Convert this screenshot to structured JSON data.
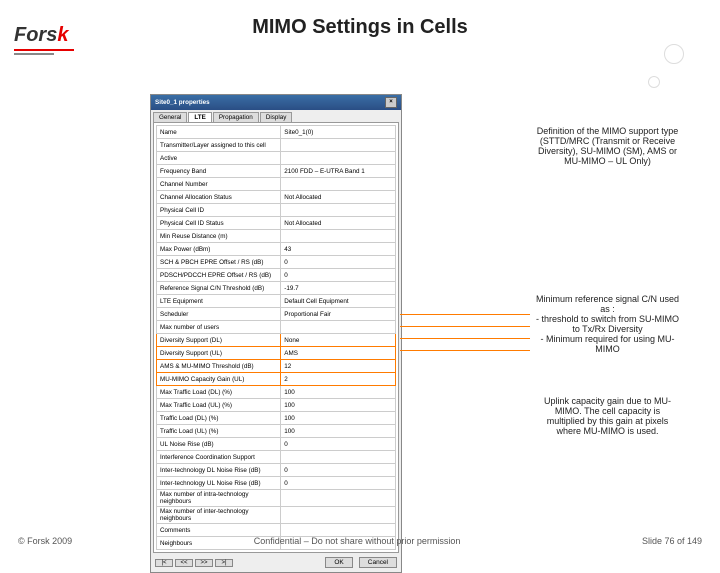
{
  "logo": {
    "text_a": "Fors",
    "text_b": "k"
  },
  "title": "MIMO Settings in Cells",
  "dialog": {
    "title": "Site0_1 properties",
    "tabs": [
      "General",
      "LTE",
      "Propagation",
      "Display"
    ],
    "active_tab_index": 1,
    "rows": [
      {
        "label": "Name",
        "value": "Site0_1(0)"
      },
      {
        "label": "Transmitter/Layer assigned to this cell",
        "value": ""
      },
      {
        "label": "Active",
        "value": ""
      },
      {
        "label": "Frequency Band",
        "value": "2100 FDD – E-UTRA Band 1"
      },
      {
        "label": "Channel Number",
        "value": ""
      },
      {
        "label": "Channel Allocation Status",
        "value": "Not Allocated"
      },
      {
        "label": "Physical Cell ID",
        "value": ""
      },
      {
        "label": "Physical Cell ID Status",
        "value": "Not Allocated"
      },
      {
        "label": "Min Reuse Distance (m)",
        "value": ""
      },
      {
        "label": "Max Power (dBm)",
        "value": "43"
      },
      {
        "label": "SCH & PBCH EPRE Offset / RS (dB)",
        "value": "0"
      },
      {
        "label": "PDSCH/PDCCH EPRE Offset / RS (dB)",
        "value": "0"
      },
      {
        "label": "Reference Signal C/N Threshold (dB)",
        "value": "-19.7"
      },
      {
        "label": "LTE Equipment",
        "value": "Default Cell Equipment"
      },
      {
        "label": "Scheduler",
        "value": "Proportional Fair"
      },
      {
        "label": "Max number of users",
        "value": ""
      },
      {
        "label": "Diversity Support (DL)",
        "value": "None",
        "hl": true
      },
      {
        "label": "Diversity Support (UL)",
        "value": "AMS",
        "hl": true
      },
      {
        "label": "AMS & MU-MIMO Threshold (dB)",
        "value": "12",
        "hl": true
      },
      {
        "label": "MU-MIMO Capacity Gain (UL)",
        "value": "2",
        "hl": true
      },
      {
        "label": "Max Traffic Load (DL) (%)",
        "value": "100"
      },
      {
        "label": "Max Traffic Load (UL) (%)",
        "value": "100"
      },
      {
        "label": "Traffic Load (DL) (%)",
        "value": "100"
      },
      {
        "label": "Traffic Load (UL) (%)",
        "value": "100"
      },
      {
        "label": "UL Noise Rise (dB)",
        "value": "0"
      },
      {
        "label": "Interference Coordination Support",
        "value": ""
      },
      {
        "label": "Inter-technology DL Noise Rise (dB)",
        "value": "0"
      },
      {
        "label": "Inter-technology UL Noise Rise (dB)",
        "value": "0"
      },
      {
        "label": "Max number of intra-technology neighbours",
        "value": ""
      },
      {
        "label": "Max number of inter-technology neighbours",
        "value": ""
      },
      {
        "label": "Comments",
        "value": ""
      },
      {
        "label": "Neighbours",
        "value": ""
      }
    ],
    "nav": [
      "|<",
      "<<",
      ">>",
      ">|"
    ],
    "buttons": {
      "ok": "OK",
      "cancel": "Cancel"
    }
  },
  "callouts": {
    "c1": "Definition of the MIMO support type (STTD/MRC (Transmit or Receive Diversity), SU-MIMO (SM), AMS or MU-MIMO – UL Only)",
    "c2": "Minimum reference signal C/N used as :\n- threshold to switch from SU-MIMO to Tx/Rx Diversity\n- Minimum required for using MU-MIMO",
    "c3": "Uplink capacity gain due to MU-MIMO. The cell capacity is multiplied by this gain at pixels where MU-MIMO is used."
  },
  "footer": {
    "left": "© Forsk 2009",
    "center": "Confidential – Do not share without prior permission",
    "right": "Slide 76 of 149"
  }
}
